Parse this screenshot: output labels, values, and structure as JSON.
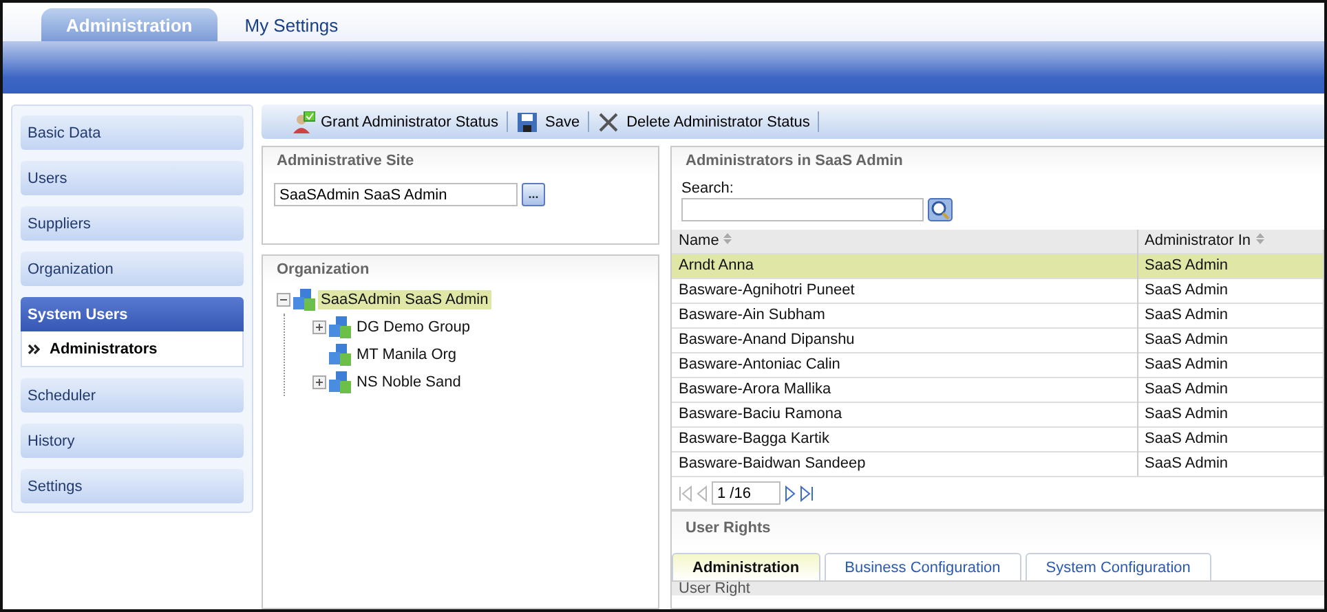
{
  "top_tabs": [
    {
      "label": "Administration",
      "selected": true
    },
    {
      "label": "My Settings",
      "selected": false
    }
  ],
  "sidebar": {
    "items": [
      {
        "label": "Basic Data",
        "selected": false
      },
      {
        "label": "Users",
        "selected": false
      },
      {
        "label": "Suppliers",
        "selected": false
      },
      {
        "label": "Organization",
        "selected": false
      },
      {
        "label": "System Users",
        "selected": true,
        "children": [
          {
            "label": "Administrators",
            "selected": true
          }
        ]
      },
      {
        "label": "Scheduler",
        "selected": false
      },
      {
        "label": "History",
        "selected": false
      },
      {
        "label": "Settings",
        "selected": false
      }
    ]
  },
  "toolbar": [
    {
      "kind": "grant",
      "label": "Grant Administrator Status"
    },
    {
      "kind": "save",
      "label": "Save"
    },
    {
      "kind": "delete",
      "label": "Delete Administrator Status"
    }
  ],
  "administrative_site": {
    "title": "Administrative Site",
    "value": "SaaSAdmin SaaS Admin",
    "browse_label": "..."
  },
  "organization": {
    "title": "Organization",
    "tree": [
      {
        "label": "SaaSAdmin SaaS Admin",
        "selected": true,
        "expanded": true,
        "children": [
          {
            "label": "DG Demo Group",
            "selected": false,
            "expanded": false
          },
          {
            "label": "MT Manila Org",
            "selected": false
          },
          {
            "label": "NS Noble Sand",
            "selected": false,
            "expanded": false
          }
        ]
      }
    ]
  },
  "administrators": {
    "title": "Administrators in SaaS Admin",
    "search_label": "Search:",
    "table": {
      "columns": [
        "Name",
        "Administrator In"
      ],
      "rows": [
        {
          "cells": [
            "Arndt Anna",
            "SaaS Admin"
          ],
          "selected": true
        },
        {
          "cells": [
            "Basware-Agnihotri Puneet",
            "SaaS Admin"
          ],
          "selected": false
        },
        {
          "cells": [
            "Basware-Ain Subham",
            "SaaS Admin"
          ],
          "selected": false
        },
        {
          "cells": [
            "Basware-Anand Dipanshu",
            "SaaS Admin"
          ],
          "selected": false
        },
        {
          "cells": [
            "Basware-Antoniac Calin",
            "SaaS Admin"
          ],
          "selected": false
        },
        {
          "cells": [
            "Basware-Arora Mallika",
            "SaaS Admin"
          ],
          "selected": false
        },
        {
          "cells": [
            "Basware-Baciu Ramona",
            "SaaS Admin"
          ],
          "selected": false
        },
        {
          "cells": [
            "Basware-Bagga Kartik",
            "SaaS Admin"
          ],
          "selected": false
        },
        {
          "cells": [
            "Basware-Baidwan Sandeep",
            "SaaS Admin"
          ],
          "selected": false
        }
      ]
    },
    "pager": {
      "page": "1 /16",
      "first_disabled": true,
      "last_disabled": false
    }
  },
  "user_rights": {
    "title": "User Rights",
    "tabs": [
      {
        "label": "Administration",
        "selected": true
      },
      {
        "label": "Business Configuration",
        "selected": false
      },
      {
        "label": "System Configuration",
        "selected": false
      }
    ],
    "columns": [
      "User Right"
    ]
  }
}
